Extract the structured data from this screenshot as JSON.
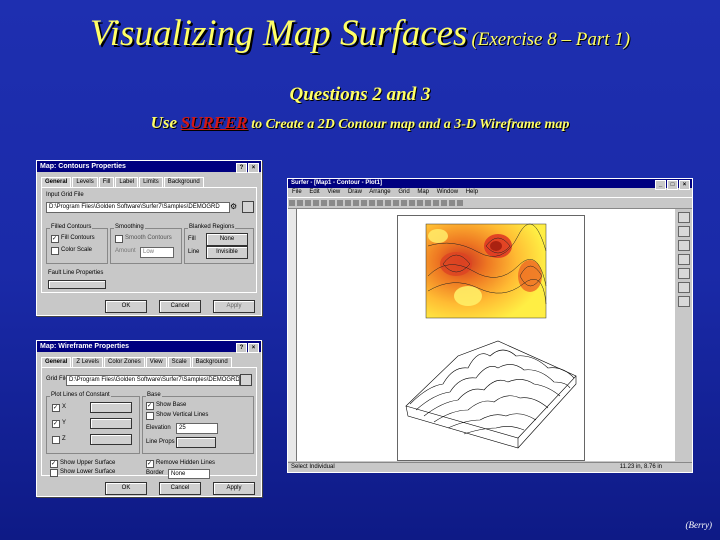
{
  "slide": {
    "title_main": "Visualizing Map Surfaces",
    "title_sub": "(Exercise 8 – Part 1)",
    "questions": "Questions 2 and 3",
    "use_prefix": "Use",
    "use_software": "SURFER",
    "use_rest": "to Create a 2D Contour map and a 3-D Wireframe map",
    "credit": "(Berry)"
  },
  "contour_dialog": {
    "title": "Map: Contours Properties",
    "tabs": [
      "General",
      "Levels",
      "Fill",
      "Label",
      "Limits",
      "Background"
    ],
    "input_file_label": "Input Grid File",
    "input_file_value": "D:\\Program Files\\Golden Software\\Surfer7\\Samples\\DEMOGRD",
    "filled_contours_label": "Filled Contours",
    "fill_contours_opt": "Fill Contours",
    "color_scale_opt": "Color Scale",
    "smoothing_label": "Smoothing",
    "smooth_contours_opt": "Smooth Contours",
    "amount_label": "Amount",
    "amount_value": "Low",
    "blanked_label": "Blanked Regions",
    "fill_label": "Fill",
    "fill_value": "None",
    "line_label": "Line",
    "line_value": "Invisible",
    "fault_label": "Fault Line Properties",
    "ok": "OK",
    "cancel": "Cancel",
    "apply": "Apply"
  },
  "wireframe_dialog": {
    "title": "Map: Wireframe Properties",
    "tabs": [
      "General",
      "Z Levels",
      "Color Zones",
      "View",
      "Scale",
      "Background"
    ],
    "grid_file_label": "Grid File",
    "grid_file_value": "D:\\Program Files\\Golden Software\\Surfer7\\Samples\\DEMOGRD",
    "plot_lines_label": "Plot Lines of Constant",
    "x_opt": "X",
    "y_opt": "Y",
    "z_opt": "Z",
    "base_label": "Base",
    "show_base_opt": "Show Base",
    "show_vertical_lines_opt": "Show Vertical Lines",
    "elevation_label": "Elevation",
    "elevation_value": "25",
    "line_props_label": "Line Props",
    "hide_upper_opt": "Show Upper Surface",
    "show_lower_opt": "Show Lower Surface",
    "remove_hidden_opt": "Remove Hidden Lines",
    "border_label": "Border",
    "border_value": "None",
    "ok": "OK",
    "cancel": "Cancel",
    "apply": "Apply"
  },
  "surfer_window": {
    "title": "Surfer - [Map1 - Contour - Plot1]",
    "menus": [
      "File",
      "Edit",
      "View",
      "Draw",
      "Arrange",
      "Grid",
      "Map",
      "Window",
      "Help"
    ],
    "status_left": "Select Individual",
    "status_right": "11.23 in, 8.76 in"
  }
}
